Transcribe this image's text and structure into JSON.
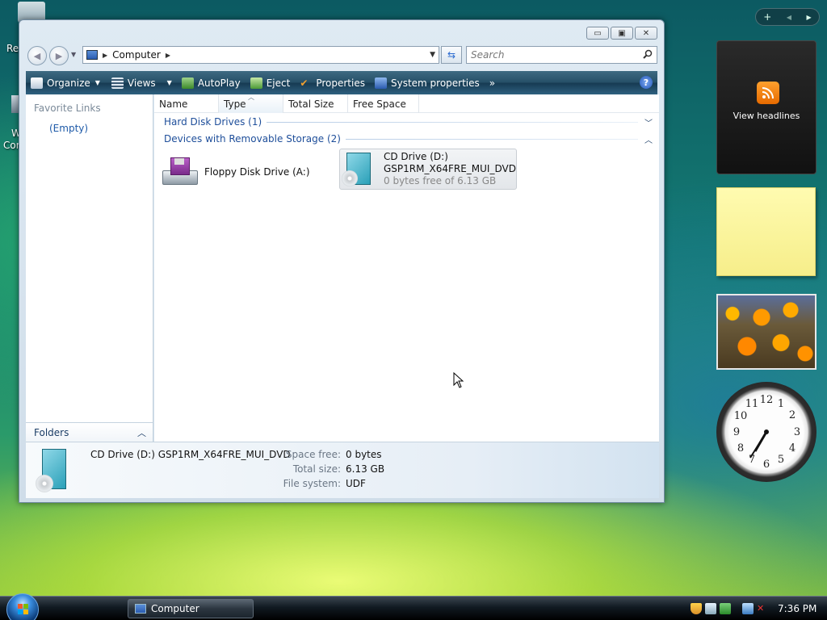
{
  "desktop": {
    "icon_labels": [
      "Re",
      "W",
      "Cor"
    ]
  },
  "sidebar_controls": {
    "add": "+",
    "prev": "◀",
    "next": "▶"
  },
  "gadgets": {
    "feed_label": "View headlines",
    "clock_numbers": [
      "12",
      "1",
      "2",
      "3",
      "4",
      "5",
      "6",
      "7",
      "8",
      "9",
      "10",
      "11"
    ]
  },
  "window": {
    "caption": {
      "minimize": "▭",
      "maximize": "▣",
      "close": "✕"
    },
    "address": {
      "location": "Computer"
    },
    "search": {
      "placeholder": "Search"
    },
    "toolbar": {
      "items": [
        "Organize",
        "Views",
        "AutoPlay",
        "Eject",
        "Properties",
        "System properties"
      ],
      "more": "»",
      "help": "?"
    },
    "nav_pane": {
      "title": "Favorite Links",
      "empty": "(Empty)",
      "folders": "Folders"
    },
    "columns": [
      "Name",
      "Type",
      "Total Size",
      "Free Space"
    ],
    "groups": {
      "hard_disks": "Hard Disk Drives (1)",
      "removable": "Devices with Removable Storage (2)"
    },
    "items": {
      "floppy": {
        "name": "Floppy Disk Drive (A:)"
      },
      "cd": {
        "name": "CD Drive (D:)",
        "label": "GSP1RM_X64FRE_MUI_DVD",
        "free": "0 bytes free of 6.13 GB"
      }
    },
    "details": {
      "title": "CD Drive (D:) GSP1RM_X64FRE_MUI_DVD",
      "space_free_label": "Space free:",
      "space_free": "0 bytes",
      "total_size_label": "Total size:",
      "total_size": "6.13 GB",
      "file_system_label": "File system:",
      "file_system": "UDF"
    }
  },
  "taskbar": {
    "task_label": "Computer",
    "clock": "7:36 PM"
  },
  "colors": {
    "toolbar": "#254e66",
    "link": "#1e4e9a",
    "notes": "#fffbb0"
  }
}
